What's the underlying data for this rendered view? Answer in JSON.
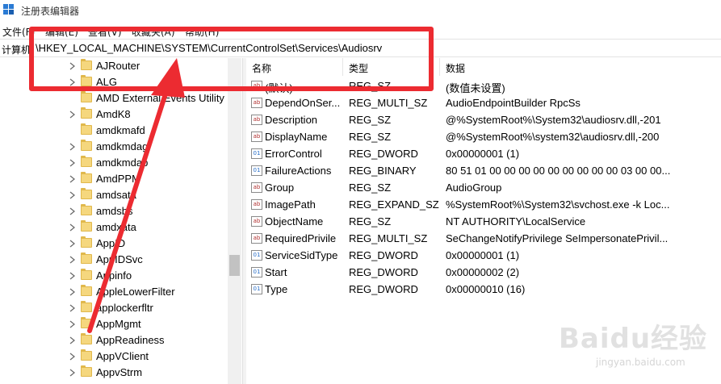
{
  "window": {
    "title": "注册表编辑器"
  },
  "menu": [
    "文件(F)",
    "编辑(E)",
    "查看(V)",
    "收藏夹(A)",
    "帮助(H)"
  ],
  "address": {
    "label": "计算机",
    "path": "\\HKEY_LOCAL_MACHINE\\SYSTEM\\CurrentControlSet\\Services\\Audiosrv"
  },
  "tree_items": [
    "AJRouter",
    "ALG",
    "AMD External Events Utility",
    "AmdK8",
    "amdkmafd",
    "amdkmdag",
    "amdkmdap",
    "AmdPPM",
    "amdsata",
    "amdsbs",
    "amdxata",
    "AppID",
    "AppIDSvc",
    "Appinfo",
    "AppleLowerFilter",
    "applockerfltr",
    "AppMgmt",
    "AppReadiness",
    "AppVClient",
    "AppvStrm"
  ],
  "columns": {
    "name": "名称",
    "type": "类型",
    "data": "数据"
  },
  "values": [
    {
      "name": "(默认)",
      "type": "REG_SZ",
      "data": "(数值未设置)",
      "icon": "string-value-icon"
    },
    {
      "name": "DependOnSer...",
      "type": "REG_MULTI_SZ",
      "data": "AudioEndpointBuilder RpcSs",
      "icon": "string-value-icon"
    },
    {
      "name": "Description",
      "type": "REG_SZ",
      "data": "@%SystemRoot%\\System32\\audiosrv.dll,-201",
      "icon": "string-value-icon"
    },
    {
      "name": "DisplayName",
      "type": "REG_SZ",
      "data": "@%SystemRoot%\\system32\\audiosrv.dll,-200",
      "icon": "string-value-icon"
    },
    {
      "name": "ErrorControl",
      "type": "REG_DWORD",
      "data": "0x00000001 (1)",
      "icon": "binary-value-icon"
    },
    {
      "name": "FailureActions",
      "type": "REG_BINARY",
      "data": "80 51 01 00 00 00 00 00 00 00 00 00 03 00 00...",
      "icon": "binary-value-icon"
    },
    {
      "name": "Group",
      "type": "REG_SZ",
      "data": "AudioGroup",
      "icon": "string-value-icon"
    },
    {
      "name": "ImagePath",
      "type": "REG_EXPAND_SZ",
      "data": "%SystemRoot%\\System32\\svchost.exe -k Loc...",
      "icon": "string-value-icon"
    },
    {
      "name": "ObjectName",
      "type": "REG_SZ",
      "data": "NT AUTHORITY\\LocalService",
      "icon": "string-value-icon"
    },
    {
      "name": "RequiredPrivile",
      "type": "REG_MULTI_SZ",
      "data": "SeChangeNotifyPrivilege SeImpersonatePrivil...",
      "icon": "string-value-icon"
    },
    {
      "name": "ServiceSidType",
      "type": "REG_DWORD",
      "data": "0x00000001 (1)",
      "icon": "binary-value-icon"
    },
    {
      "name": "Start",
      "type": "REG_DWORD",
      "data": "0x00000002 (2)",
      "icon": "binary-value-icon"
    },
    {
      "name": "Type",
      "type": "REG_DWORD",
      "data": "0x00000010 (16)",
      "icon": "binary-value-icon"
    }
  ],
  "watermark": {
    "brand": "Baidu经验",
    "site": "jingyan.baidu.com"
  },
  "colors": {
    "annotation": "#ec2b31",
    "folder": "#f5d77e",
    "selection": "#cce8ff"
  }
}
